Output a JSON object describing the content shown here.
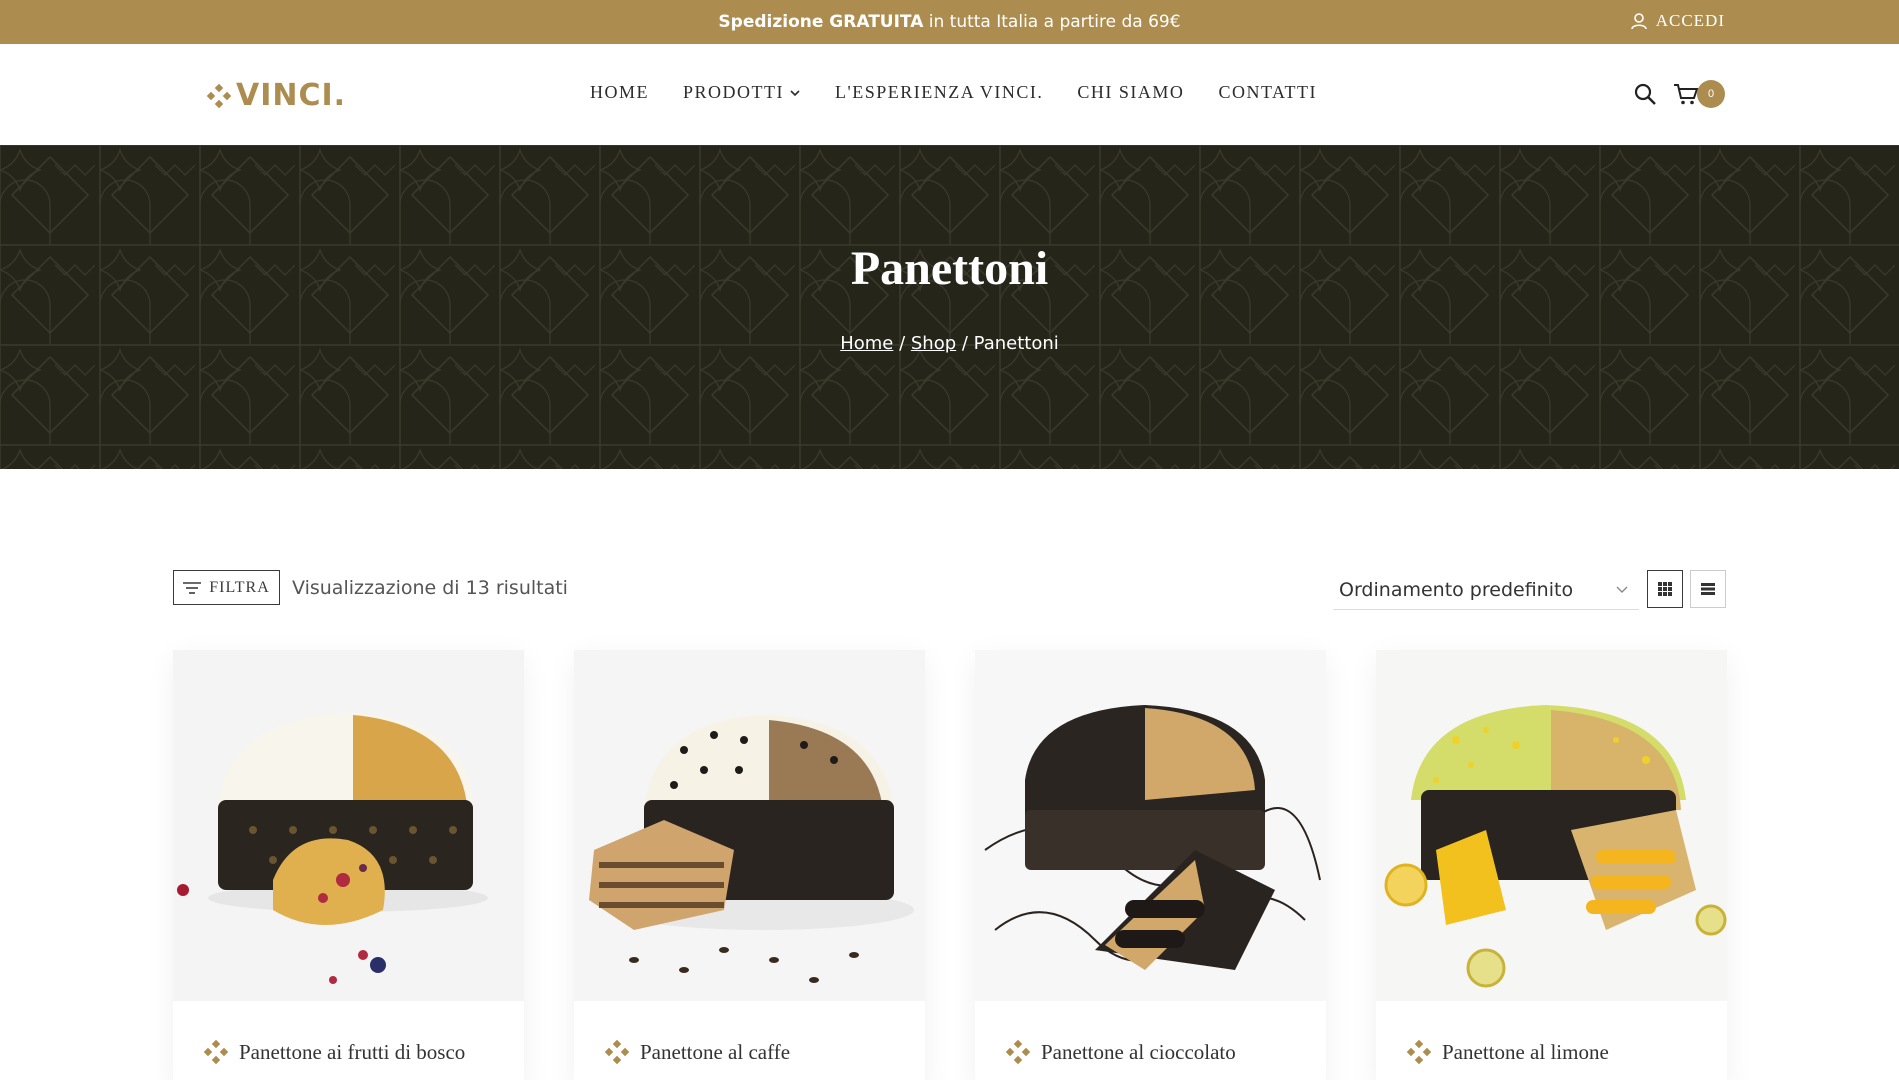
{
  "topbar": {
    "promo_bold": "Spedizione GRATUITA",
    "promo_rest": " in tutta Italia a partire da 69€",
    "login_label": "ACCEDI"
  },
  "header": {
    "logo_text": "VINCI.",
    "nav": [
      {
        "label": "HOME"
      },
      {
        "label": "PRODOTTI"
      },
      {
        "label": "L'ESPERIENZA VINCI."
      },
      {
        "label": "CHI SIAMO"
      },
      {
        "label": "CONTATTI"
      }
    ],
    "cart_count": "0"
  },
  "hero": {
    "title": "Panettoni",
    "breadcrumb": {
      "home": "Home",
      "sep1": " / ",
      "shop": "Shop",
      "sep2": " / ",
      "current": "Panettoni"
    }
  },
  "toolbar": {
    "filter_label": "FILTRA",
    "results_text": "Visualizzazione di 13 risultati",
    "sort_selected": "Ordinamento predefinito"
  },
  "products": [
    {
      "name": "Panettone ai frutti di bosco"
    },
    {
      "name": "Panettone al caffe"
    },
    {
      "name": "Panettone al cioccolato"
    },
    {
      "name": "Panettone al limone"
    }
  ],
  "colors": {
    "brand_gold": "#ad8d4f",
    "hero_bg": "#26251a",
    "text_dark": "#2c2c2c"
  }
}
